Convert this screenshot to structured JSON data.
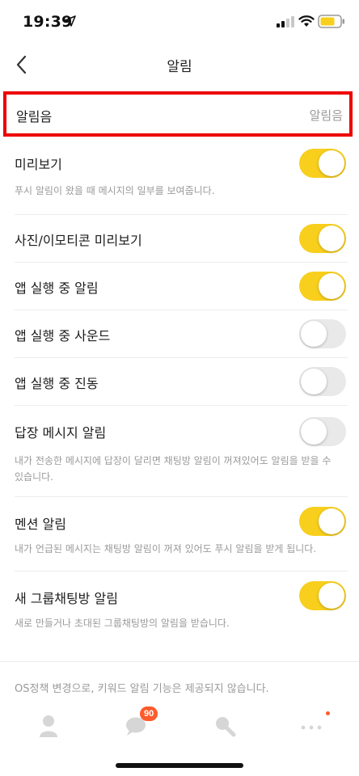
{
  "status": {
    "time": "19:39"
  },
  "nav": {
    "title": "알림",
    "back_icon": "chevron-left-icon"
  },
  "sound": {
    "label": "알림음",
    "value": "알림음"
  },
  "settings": [
    {
      "label": "미리보기",
      "on": true,
      "desc": "푸시 알림이 왔을 때 메시지의 일부를 보여줍니다."
    },
    {
      "label": "사진/이모티콘 미리보기",
      "on": true,
      "desc": ""
    },
    {
      "label": "앱 실행 중 알림",
      "on": true,
      "desc": ""
    },
    {
      "label": "앱 실행 중 사운드",
      "on": false,
      "desc": ""
    },
    {
      "label": "앱 실행 중 진동",
      "on": false,
      "desc": ""
    },
    {
      "label": "답장 메시지 알림",
      "on": false,
      "desc": "내가 전송한 메시지에 답장이 달리면 채팅방 알림이 꺼져있어도 알림을 받을 수 있습니다."
    },
    {
      "label": "멘션 알림",
      "on": true,
      "desc": "내가 언급된 메시지는 채팅방 알림이 꺼져 있어도 푸시 알림을 받게 됩니다."
    },
    {
      "label": "새 그룹채팅방 알림",
      "on": true,
      "desc": "새로 만들거나 초대된 그룹채팅방의 알림을 받습니다."
    }
  ],
  "footer": {
    "note": "OS정책 변경으로, 키워드 알림 기능은 제공되지 않습니다."
  },
  "tabs": {
    "items": [
      "friends-icon",
      "chat-icon",
      "search-icon",
      "more-icon"
    ],
    "chat_badge": "90"
  },
  "colors": {
    "toggle_on": "#f8cf1c",
    "toggle_off": "#e9e9ea",
    "highlight": "#ee0000",
    "badge": "#ff5a2b"
  }
}
